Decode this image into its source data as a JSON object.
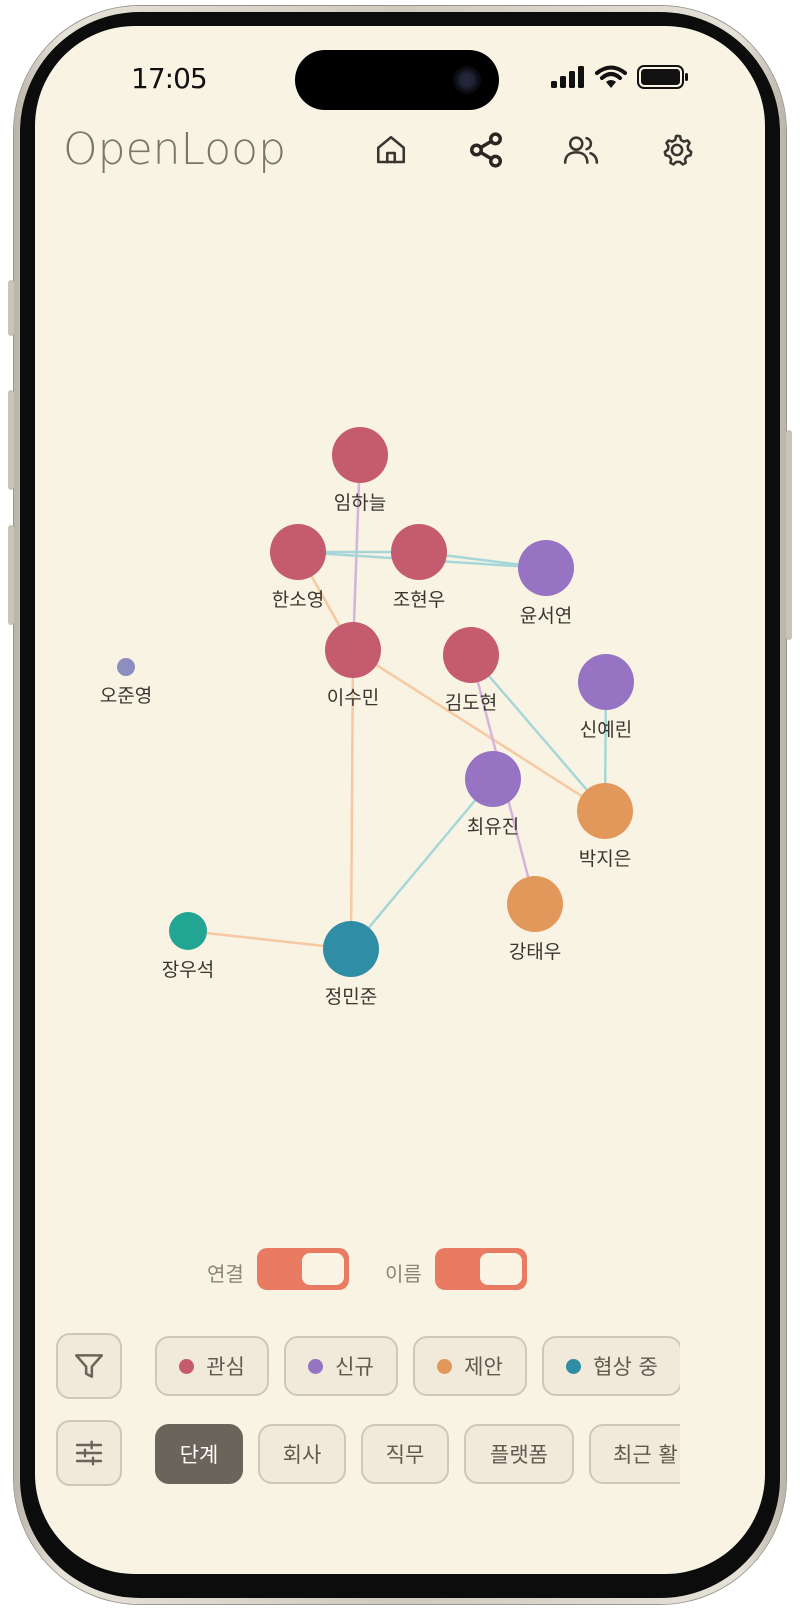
{
  "status_bar": {
    "time": "17:05"
  },
  "app": {
    "title": "OpenLoop"
  },
  "nav": [
    {
      "id": "home",
      "icon": "home-icon"
    },
    {
      "id": "share",
      "icon": "share-icon"
    },
    {
      "id": "users",
      "icon": "users-icon"
    },
    {
      "id": "settings",
      "icon": "gear-icon"
    }
  ],
  "colors": {
    "interest": "#c45b6e",
    "new": "#9673c3",
    "proposal": "#e3985b",
    "negotiation": "#2f8da6",
    "other_teal": "#22a693",
    "isolated": "#8d8dc2",
    "edge_teal": "#a6d7d8",
    "edge_orange": "#f6c9a2",
    "edge_purple": "#d5b3dc",
    "accent": "#e97b63"
  },
  "graph": {
    "nodes": [
      {
        "id": "imhaneul",
        "name": "임하늘",
        "stage": "interest"
      },
      {
        "id": "hansoyoung",
        "name": "한소영",
        "stage": "interest"
      },
      {
        "id": "johyunwoo",
        "name": "조현우",
        "stage": "interest"
      },
      {
        "id": "yunseoyeon",
        "name": "윤서연",
        "stage": "new"
      },
      {
        "id": "leesumin",
        "name": "이수민",
        "stage": "interest"
      },
      {
        "id": "kimdohyun",
        "name": "김도현",
        "stage": "interest"
      },
      {
        "id": "shinyerin",
        "name": "신예린",
        "stage": "new"
      },
      {
        "id": "ojunyoung",
        "name": "오준영",
        "stage": "isolated"
      },
      {
        "id": "choiyujin",
        "name": "최유진",
        "stage": "new"
      },
      {
        "id": "parkjieun",
        "name": "박지은",
        "stage": "proposal"
      },
      {
        "id": "kangtaewoo",
        "name": "강태우",
        "stage": "proposal"
      },
      {
        "id": "jangwooseok",
        "name": "장우석",
        "stage": "other_teal"
      },
      {
        "id": "jungminjun",
        "name": "정민준",
        "stage": "negotiation"
      }
    ],
    "edges": [
      {
        "from": "imhaneul",
        "to": "leesumin",
        "kind": "purple"
      },
      {
        "from": "hansoyoung",
        "to": "johyunwoo",
        "kind": "teal"
      },
      {
        "from": "hansoyoung",
        "to": "yunseoyeon",
        "kind": "teal"
      },
      {
        "from": "johyunwoo",
        "to": "yunseoyeon",
        "kind": "teal"
      },
      {
        "from": "hansoyoung",
        "to": "leesumin",
        "kind": "orange"
      },
      {
        "from": "leesumin",
        "to": "parkjieun",
        "kind": "orange"
      },
      {
        "from": "leesumin",
        "to": "jungminjun",
        "kind": "orange"
      },
      {
        "from": "kimdohyun",
        "to": "parkjieun",
        "kind": "teal"
      },
      {
        "from": "kimdohyun",
        "to": "kangtaewoo",
        "kind": "purple"
      },
      {
        "from": "shinyerin",
        "to": "parkjieun",
        "kind": "teal"
      },
      {
        "from": "choiyujin",
        "to": "jungminjun",
        "kind": "teal"
      },
      {
        "from": "jangwooseok",
        "to": "jungminjun",
        "kind": "orange"
      }
    ]
  },
  "toggles": [
    {
      "label": "연결",
      "on": true
    },
    {
      "label": "이름",
      "on": true
    }
  ],
  "stage_filters": [
    {
      "label": "관심",
      "color": "#c45b6e"
    },
    {
      "label": "신규",
      "color": "#9673c3"
    },
    {
      "label": "제안",
      "color": "#e3985b"
    },
    {
      "label": "협상 중",
      "color": "#2f8da6"
    }
  ],
  "group_options": [
    {
      "label": "단계",
      "active": true
    },
    {
      "label": "회사",
      "active": false
    },
    {
      "label": "직무",
      "active": false
    },
    {
      "label": "플랫폼",
      "active": false
    },
    {
      "label": "최근 활",
      "active": false
    }
  ]
}
